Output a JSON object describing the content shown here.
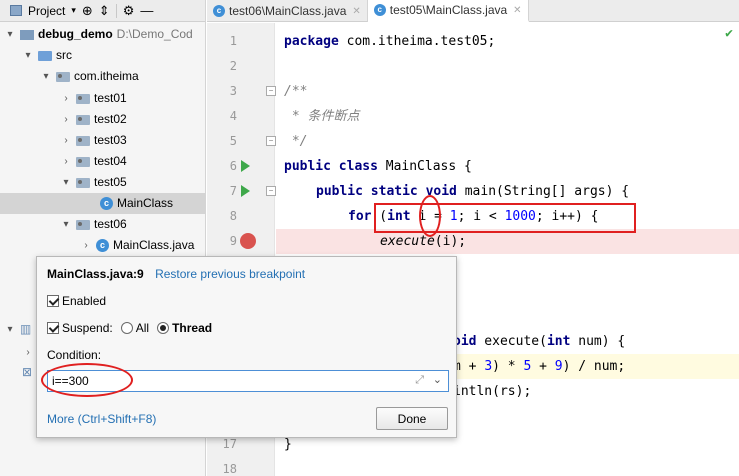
{
  "project_panel": {
    "title": "Project",
    "tree": [
      {
        "label": "debug_demo",
        "path": "D:\\Demo_Cod"
      },
      {
        "label": "src"
      },
      {
        "label": "com.itheima"
      },
      {
        "label": "test01"
      },
      {
        "label": "test02"
      },
      {
        "label": "test03"
      },
      {
        "label": "test04"
      },
      {
        "label": "test05"
      },
      {
        "label": "MainClass"
      },
      {
        "label": "test06"
      },
      {
        "label": "MainClass.java"
      }
    ]
  },
  "tabs": [
    {
      "label": "test06\\MainClass.java"
    },
    {
      "label": "test05\\MainClass.java"
    }
  ],
  "editor": {
    "line_numbers": [
      "1",
      "2",
      "3",
      "4",
      "5",
      "6",
      "7",
      "8",
      "9",
      "17",
      "18"
    ],
    "code": {
      "l1_kw": "package",
      "l1_rest": " com.itheima.test05;",
      "l3": "/**",
      "l4": " * 条件断点",
      "l5": " */",
      "l6_kw": "public class",
      "l6_rest": " MainClass {",
      "l7_kw1": "public static void",
      "l7_rest": " main(String[] args) {",
      "l8_kw": "for",
      "l8_p1": " (",
      "l8_int": "int",
      "l8_p2": " i = ",
      "l8_n1": "1",
      "l8_p3": "; i < ",
      "l8_n2": "1000",
      "l8_p4": "; i++) {",
      "l9_fn": "execute",
      "l9_rest": "(i);",
      "l_exec_kw": "oid",
      "l_exec_rest": " execute(",
      "l_exec_int": "int",
      "l_exec_end": " num) {",
      "l_calc_p1": "m + ",
      "l_calc_n1": "3",
      "l_calc_p2": ") * ",
      "l_calc_n2": "5",
      "l_calc_p3": " + ",
      "l_calc_n3": "9",
      "l_calc_p4": ") / num;",
      "l_print": "intln(rs);",
      "l17": "}"
    }
  },
  "breakpoint_popup": {
    "title": "MainClass.java:9",
    "restore_link": "Restore previous breakpoint",
    "enabled_label": "Enabled",
    "suspend_label": "Suspend:",
    "all_label": "All",
    "thread_label": "Thread",
    "condition_label": "Condition:",
    "condition_value": "i==300",
    "more_link": "More (Ctrl+Shift+F8)",
    "done_label": "Done"
  },
  "colors": {
    "highlight_red": "#e02020",
    "keyword": "#000080",
    "number": "#0000ff",
    "link": "#2470b3"
  }
}
